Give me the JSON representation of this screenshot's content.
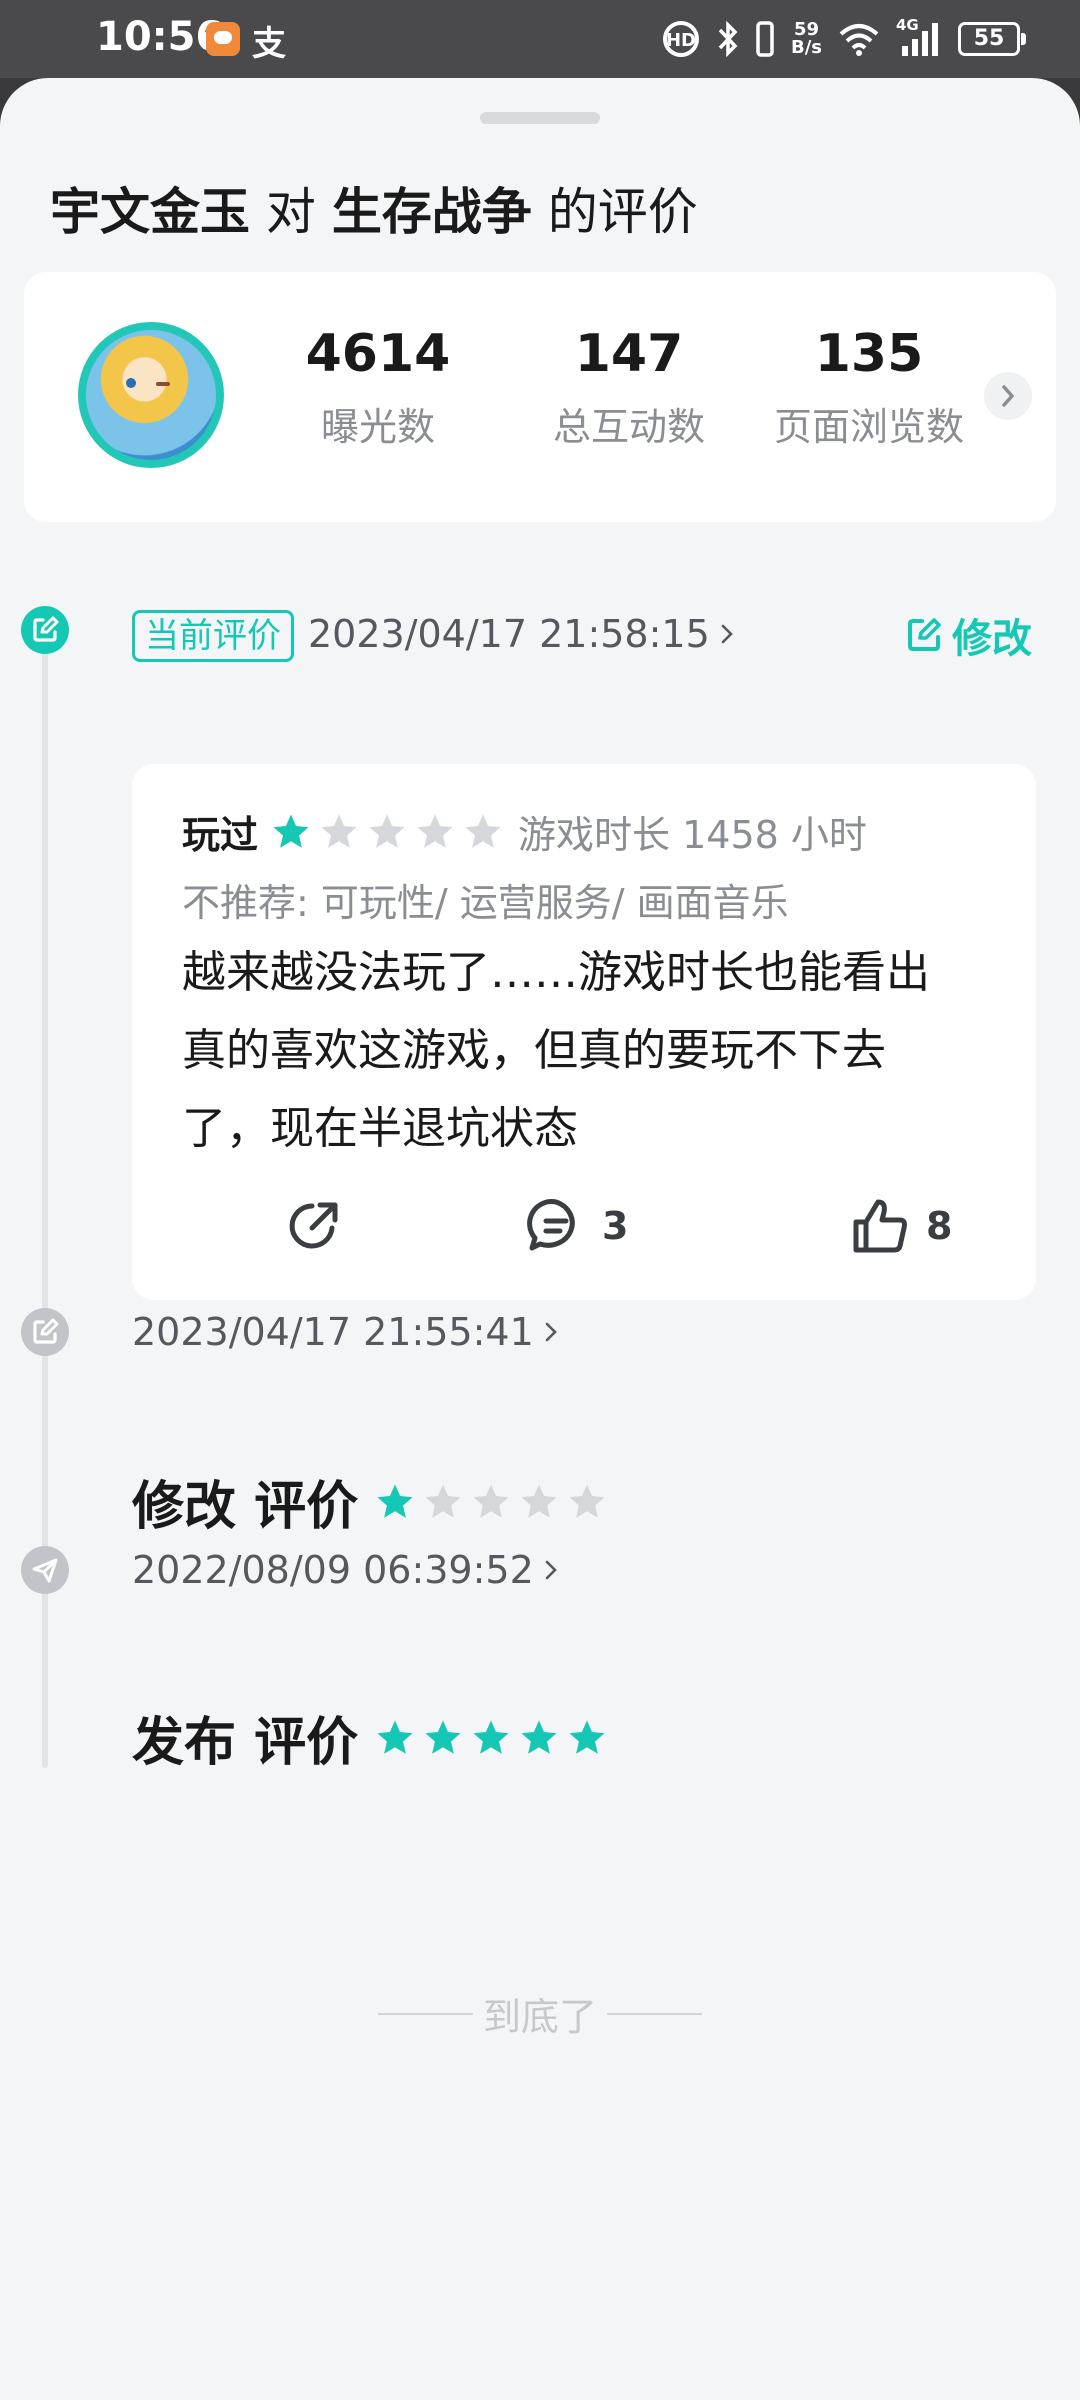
{
  "status_bar": {
    "time": "10:56",
    "app2_glyph": "支",
    "net_speed_value": "59",
    "net_speed_unit": "B/s",
    "signal_type": "4G",
    "battery": "55"
  },
  "header": {
    "user": "宇文金玉",
    "connector": "对",
    "game": "生存战争",
    "suffix": "的评价"
  },
  "stats": {
    "items": [
      {
        "value": "4614",
        "label": "曝光数"
      },
      {
        "value": "147",
        "label": "总互动数"
      },
      {
        "value": "135",
        "label": "页面浏览数"
      }
    ]
  },
  "current": {
    "badge": "当前评价",
    "time": "2023/04/17 21:58:15",
    "edit_label": "修改",
    "status": "玩过",
    "rating": 1,
    "duration": "游戏时长 1458 小时",
    "tags": "不推荐: 可玩性/ 运营服务/ 画面音乐",
    "body": "越来越没法玩了……游戏时长也能看出真的喜欢这游戏，但真的要玩不下去了，现在半退坑状态",
    "comment_count": "3",
    "like_count": "8"
  },
  "history": [
    {
      "time": "2023/04/17 21:55:41",
      "title": "修改 评价",
      "rating": 1
    },
    {
      "time": "2022/08/09 06:39:52",
      "title": "发布 评价",
      "rating": 5
    }
  ],
  "footer": {
    "end_text": "到底了"
  },
  "colors": {
    "accent": "#14c8b5",
    "star_empty": "#d5d7db",
    "muted_text": "#8a8d93"
  }
}
